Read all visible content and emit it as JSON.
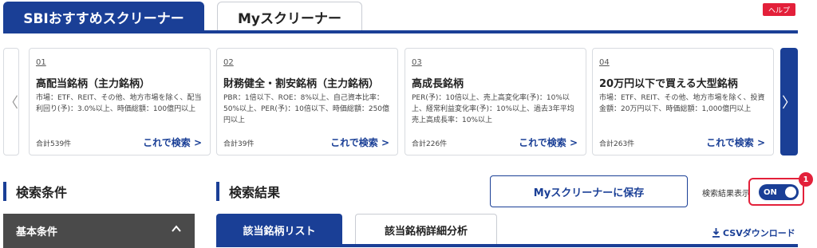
{
  "top_tabs": {
    "active": "SBIおすすめスクリーナー",
    "inactive": "Myスクリーナー"
  },
  "help": "ヘルプ",
  "carousel": {
    "prev": "〈",
    "next": "〉",
    "cards": [
      {
        "num": "01",
        "title": "高配当銘柄（主力銘柄）",
        "desc": "市場：ETF、REIT、その他、地方市場を除く、配当利回り(予)：3.0%以上、時価総額：100億円以上",
        "count": "合計539件",
        "link": "これで検索 >"
      },
      {
        "num": "02",
        "title": "財務健全・割安銘柄（主力銘柄）",
        "desc": "PBR：1倍以下、ROE：8%以上、自己資本比率：50%以上、PER(予)：10倍以下、時価総額：250億円以上",
        "count": "合計39件",
        "link": "これで検索 >"
      },
      {
        "num": "03",
        "title": "高成長銘柄",
        "desc": "PER(予)：10倍以上、売上高変化率(予)：10%以上、経常利益変化率(予)：10%以上、過去3年平均売上高成長率：10%以上",
        "count": "合計226件",
        "link": "これで検索 >"
      },
      {
        "num": "04",
        "title": "20万円以下で買える大型銘柄",
        "desc": "市場：ETF、REIT、その他、地方市場を除く、投資金額：20万円以下、時価総額：1,000億円以上",
        "count": "合計263件",
        "link": "これで検索 >"
      }
    ]
  },
  "left": {
    "heading": "検索条件",
    "basic": "基本条件"
  },
  "results": {
    "heading": "検索結果",
    "save_button": "Myスクリーナーに保存",
    "toggle_label": "検索結果表示",
    "toggle_state": "ON",
    "step": "1",
    "tab_active": "該当銘柄リスト",
    "tab_inactive": "該当銘柄詳細分析",
    "csv": "CSVダウンロード"
  },
  "colors": {
    "primary": "#1a3f96",
    "accent": "#e3203a",
    "dark_bar": "#4a4a4a"
  }
}
